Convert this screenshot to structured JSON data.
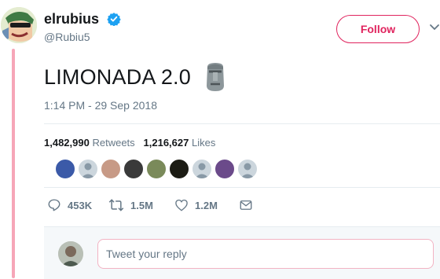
{
  "author": {
    "name": "elrubius",
    "handle": "@Rubiu5",
    "verified": true
  },
  "follow_button": {
    "label": "Follow"
  },
  "tweet": {
    "text": "LIMONADA 2.0",
    "emoji": "moai",
    "timestamp": "1:14 PM - 29 Sep 2018"
  },
  "stats": {
    "retweets_count": "1,482,990",
    "retweets_label": "Retweets",
    "likes_count": "1,216,627",
    "likes_label": "Likes"
  },
  "liked_by_avatars": 9,
  "actions": {
    "replies": "453K",
    "retweets": "1.5M",
    "likes": "1.2M"
  },
  "reply": {
    "placeholder": "Tweet your reply"
  },
  "colors": {
    "accent": "#e0245e",
    "thread_line": "#f6a6b8",
    "secondary_text": "#657786",
    "verified": "#1da1f2"
  }
}
